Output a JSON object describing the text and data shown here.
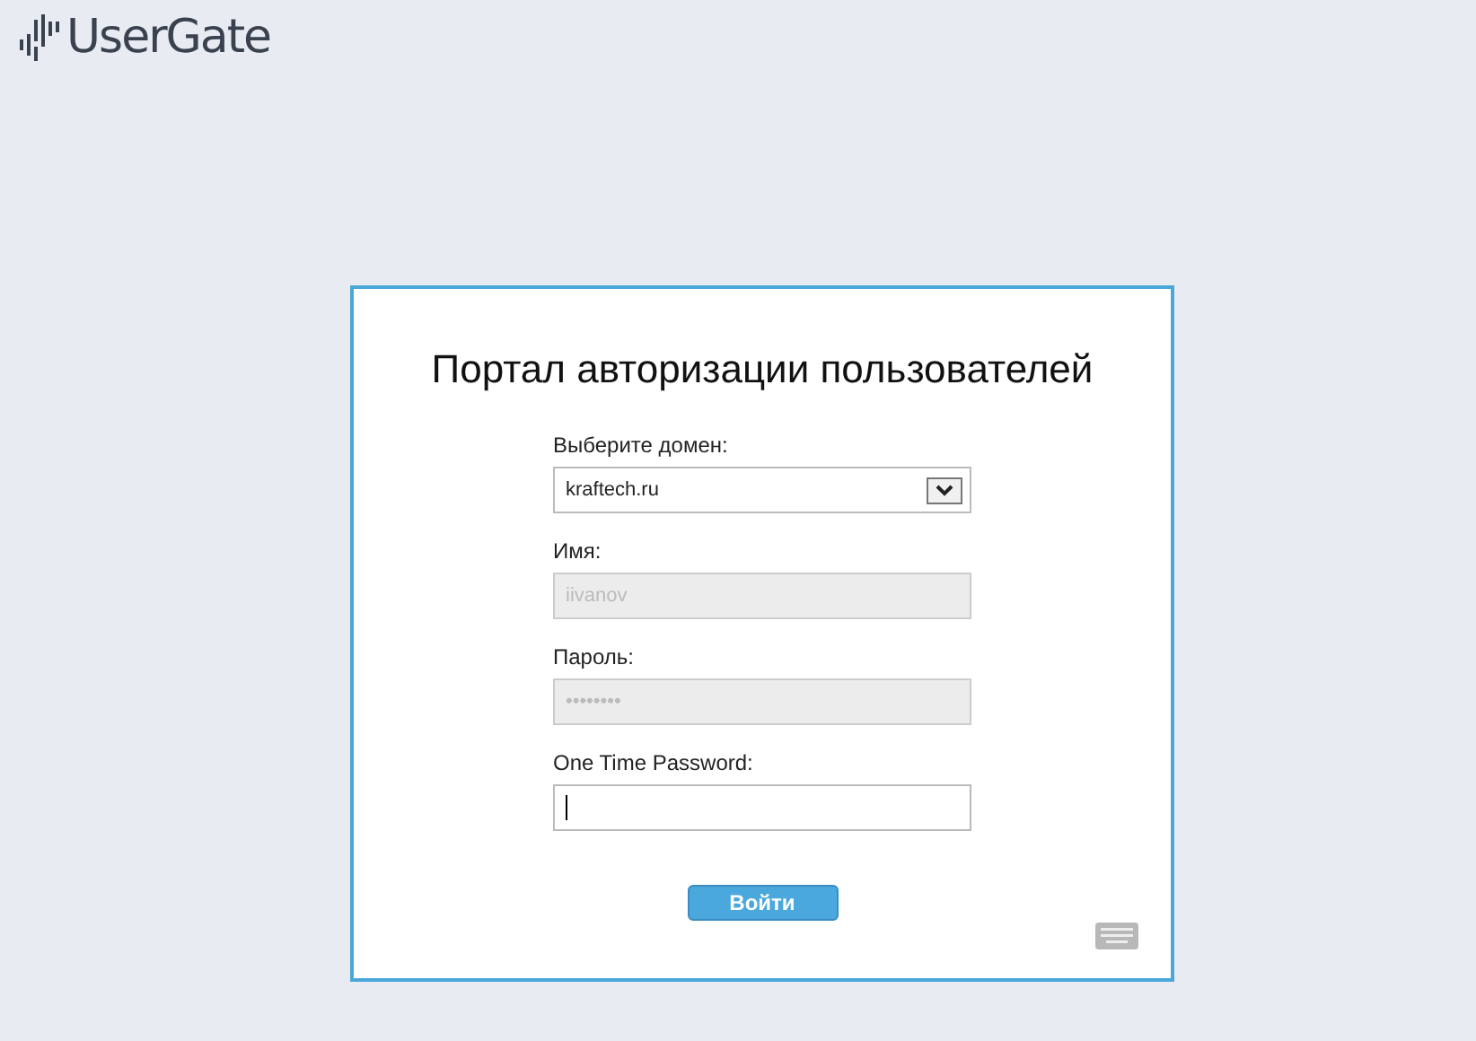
{
  "logo": {
    "text": "UserGate"
  },
  "form": {
    "title": "Портал авторизации пользователей",
    "fields": [
      {
        "kind": "select",
        "label": "Выберите домен:",
        "value": "kraftech.ru",
        "disabled": false
      },
      {
        "kind": "text",
        "label": "Имя:",
        "value": "iivanov",
        "disabled": true
      },
      {
        "kind": "text",
        "label": "Пароль:",
        "value": "••••••••",
        "disabled": true
      },
      {
        "kind": "text",
        "label": "One Time Password:",
        "disabled": false,
        "focused": true
      }
    ],
    "submit": "Войти"
  }
}
